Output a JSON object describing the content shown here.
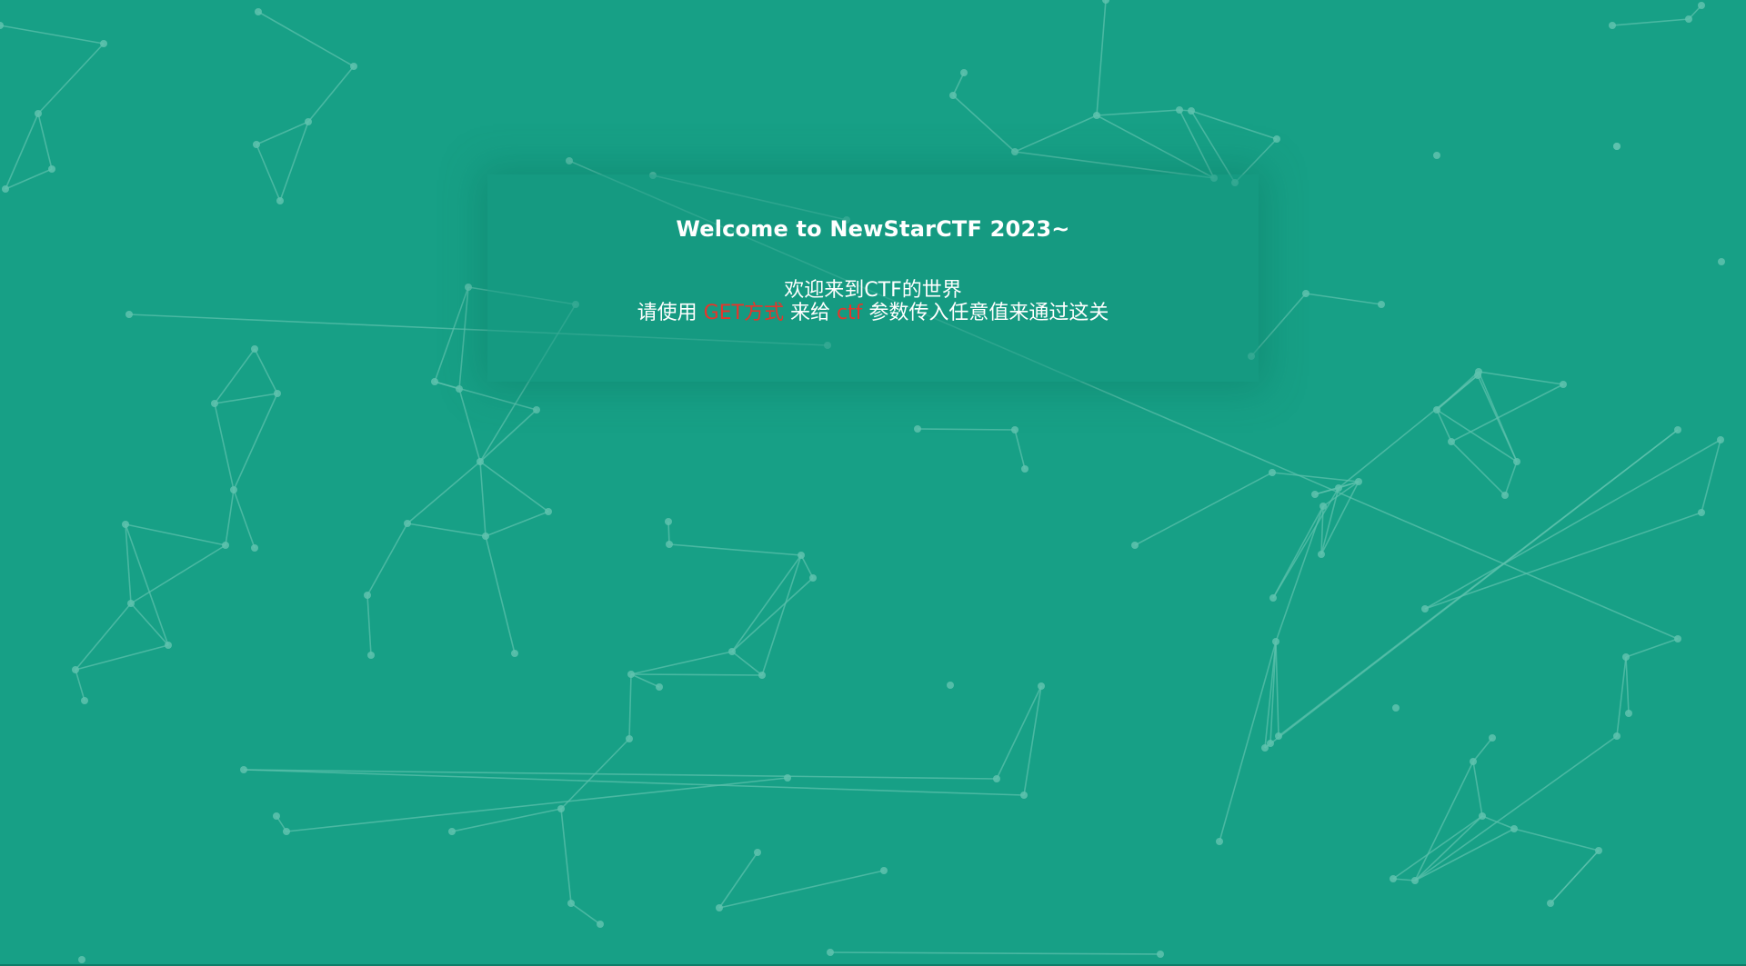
{
  "panel": {
    "title": "Welcome to NewStarCTF 2023~",
    "welcome": "欢迎来到CTF的世界",
    "instruction": {
      "part1": "请使用 ",
      "method": "GET方式",
      "part2": " 来给 ",
      "param": "ctf",
      "part3": " 参数传入任意值来通过这关"
    }
  },
  "colors": {
    "background": "#17a086",
    "highlight": "#e8342a",
    "text": "#ffffff",
    "particle": "#5fc2ae"
  }
}
